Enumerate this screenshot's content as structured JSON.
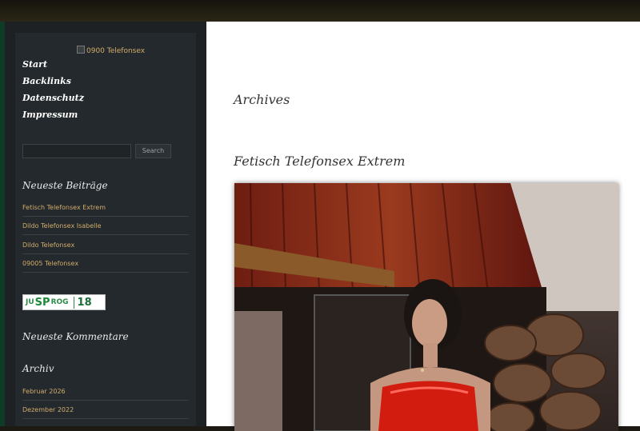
{
  "site": {
    "logo_alt": "0900 Telefonsex"
  },
  "nav": {
    "items": [
      {
        "label": "Start"
      },
      {
        "label": "Backlinks"
      },
      {
        "label": "Datenschutz"
      },
      {
        "label": "Impressum"
      }
    ]
  },
  "search": {
    "placeholder": "",
    "button_label": "Search"
  },
  "widgets": {
    "recent_posts": {
      "title": "Neueste Beiträge",
      "items": [
        "Fetisch Telefonsex Extrem",
        "Dildo Telefonsex Isabelle",
        "Dildo Telefonsex",
        "09005 Telefonsex"
      ]
    },
    "badge": {
      "jus": "JU",
      "sp": "SP",
      "prog": "ROG",
      "age": "18"
    },
    "recent_comments": {
      "title": "Neueste Kommentare"
    },
    "archive": {
      "title": "Archiv",
      "items": [
        "Februar 2026",
        "Dezember 2022"
      ]
    }
  },
  "main": {
    "page_title": "Archives",
    "post_title": "Fetisch Telefonsex Extrem"
  },
  "colors": {
    "link": "#d3ac6b",
    "sidebar_bg": "#23292d",
    "content_bg": "#ffffff"
  }
}
